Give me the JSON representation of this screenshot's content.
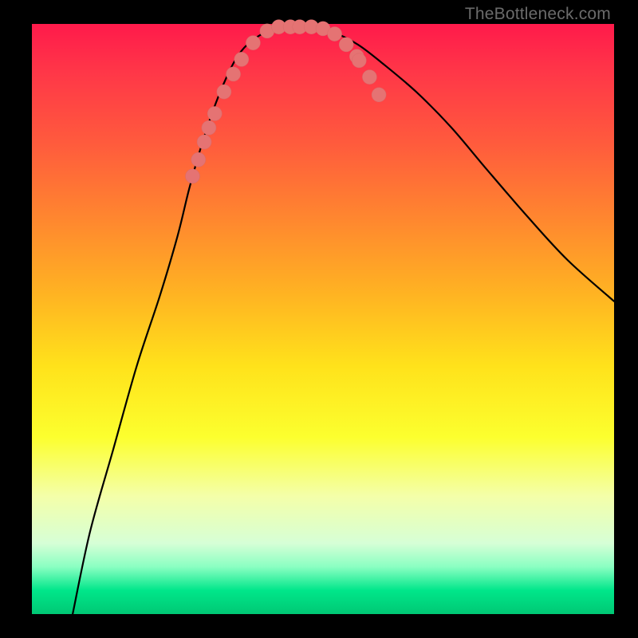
{
  "watermark": "TheBottleneck.com",
  "chart_data": {
    "type": "line",
    "title": "",
    "xlabel": "",
    "ylabel": "",
    "xlim": [
      0,
      100
    ],
    "ylim": [
      0,
      100
    ],
    "series": [
      {
        "name": "bottleneck-curve",
        "x_norm": [
          0.07,
          0.1,
          0.14,
          0.18,
          0.22,
          0.25,
          0.27,
          0.29,
          0.31,
          0.33,
          0.35,
          0.37,
          0.4,
          0.44,
          0.48,
          0.52,
          0.56,
          0.6,
          0.66,
          0.72,
          0.78,
          0.85,
          0.92,
          1.0
        ],
        "y_norm": [
          0.0,
          0.14,
          0.28,
          0.42,
          0.54,
          0.64,
          0.72,
          0.79,
          0.85,
          0.9,
          0.94,
          0.965,
          0.985,
          0.995,
          0.995,
          0.985,
          0.965,
          0.935,
          0.885,
          0.825,
          0.755,
          0.675,
          0.6,
          0.53
        ]
      }
    ],
    "markers": {
      "name": "sampled-points",
      "x_norm": [
        0.276,
        0.286,
        0.296,
        0.304,
        0.314,
        0.33,
        0.346,
        0.36,
        0.38,
        0.404,
        0.424,
        0.444,
        0.46,
        0.48,
        0.5,
        0.52,
        0.54,
        0.558,
        0.562,
        0.58,
        0.596
      ],
      "y_norm": [
        0.742,
        0.77,
        0.8,
        0.824,
        0.848,
        0.885,
        0.915,
        0.94,
        0.968,
        0.988,
        0.995,
        0.995,
        0.995,
        0.995,
        0.992,
        0.983,
        0.965,
        0.945,
        0.938,
        0.91,
        0.88
      ]
    },
    "gradient_stops": [
      {
        "pos": 0.0,
        "color": "#ff1a4b"
      },
      {
        "pos": 0.5,
        "color": "#ffd21b"
      },
      {
        "pos": 0.95,
        "color": "#00e68a"
      }
    ]
  }
}
